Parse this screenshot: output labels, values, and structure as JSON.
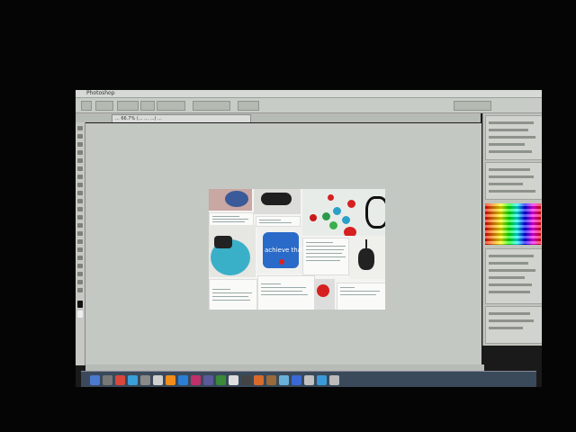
{
  "app": {
    "title": "Photoshop"
  },
  "document": {
    "tab_label": "... 66.7% (... … ...) ..."
  },
  "artwork": {
    "overlay_text": "achieve that"
  },
  "colors": {
    "canvas_bg": "#c4c8c3",
    "chrome": "#c8ccc6",
    "dock": "#3a4a5a"
  },
  "dock_icons": [
    {
      "name": "finder-icon",
      "color": "#4a7bd1"
    },
    {
      "name": "launchpad-icon",
      "color": "#777777"
    },
    {
      "name": "chrome-icon",
      "color": "#d9463a"
    },
    {
      "name": "safari-icon",
      "color": "#3aa0d9"
    },
    {
      "name": "app-icon",
      "color": "#8a8a8a"
    },
    {
      "name": "app-icon",
      "color": "#cfcfcf"
    },
    {
      "name": "illustrator-icon",
      "color": "#f28c1b"
    },
    {
      "name": "photoshop-icon",
      "color": "#2a7fd4"
    },
    {
      "name": "indesign-icon",
      "color": "#c0306a"
    },
    {
      "name": "app-icon",
      "color": "#5a5a9a"
    },
    {
      "name": "app-icon",
      "color": "#3a8a3a"
    },
    {
      "name": "app-icon",
      "color": "#dddddd"
    },
    {
      "name": "app-icon",
      "color": "#444444"
    },
    {
      "name": "app-icon",
      "color": "#d86a2a"
    },
    {
      "name": "app-icon",
      "color": "#9a6a3a"
    },
    {
      "name": "app-icon",
      "color": "#6ab0d8"
    },
    {
      "name": "app-icon",
      "color": "#3a6ad8"
    },
    {
      "name": "app-icon",
      "color": "#c0c0c0"
    },
    {
      "name": "app-icon",
      "color": "#3a9ad8"
    },
    {
      "name": "trash-icon",
      "color": "#bbbbbb"
    }
  ]
}
